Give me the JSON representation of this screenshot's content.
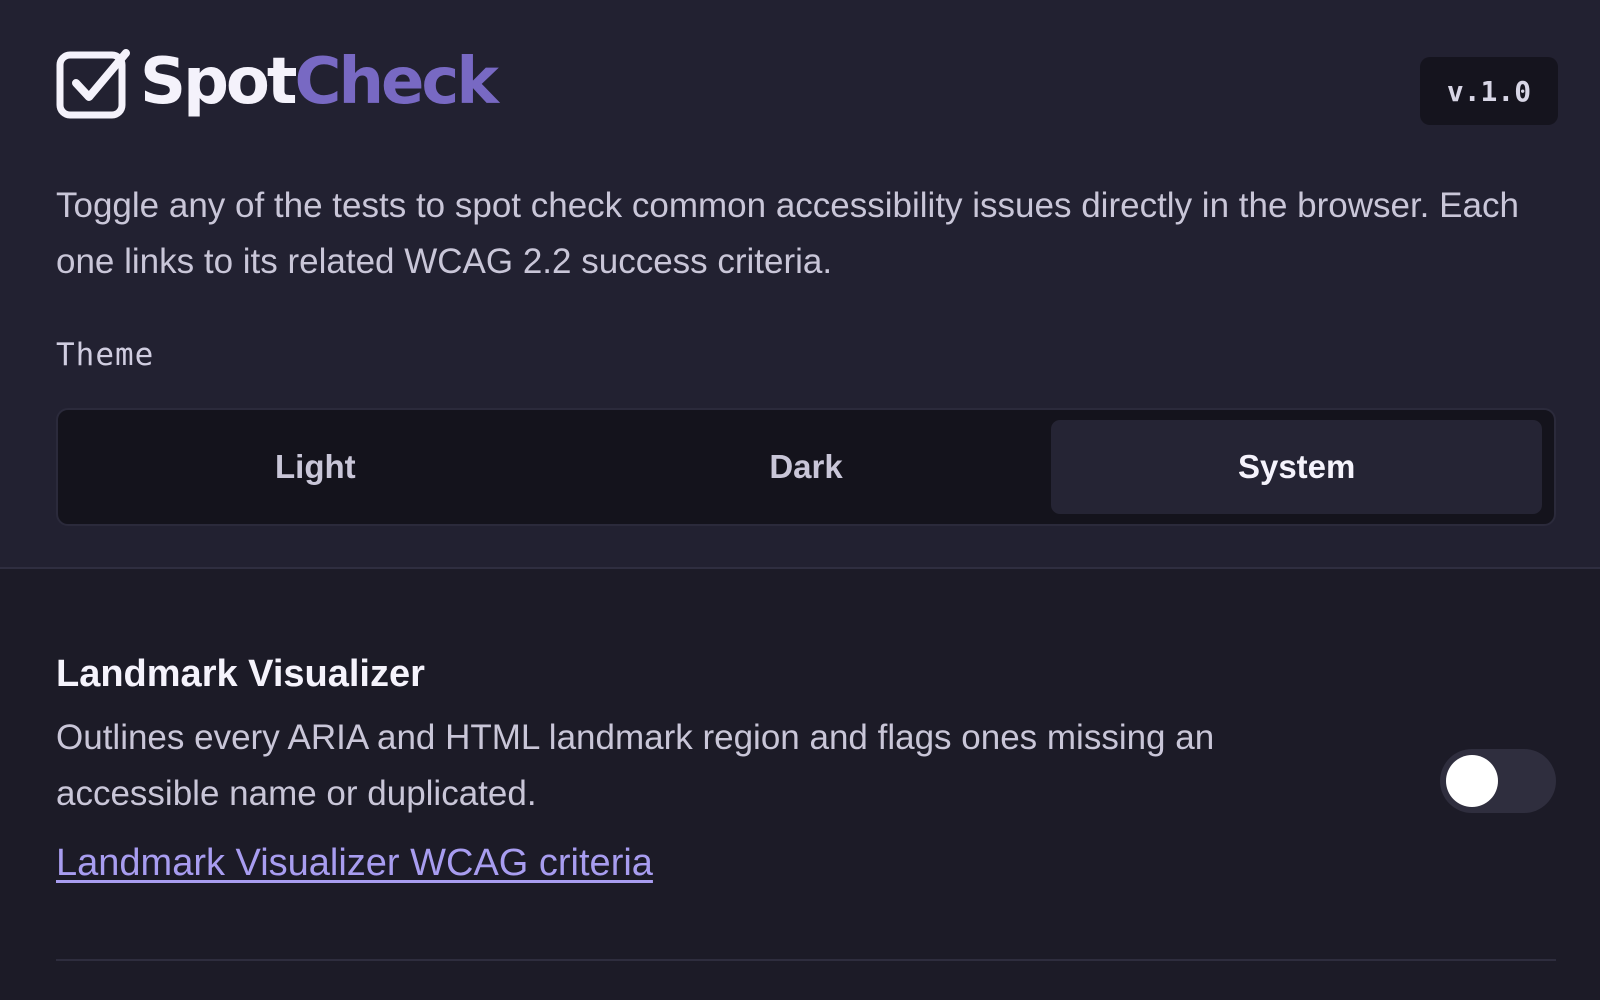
{
  "brand": {
    "name_part1": "Spot",
    "name_part2": "Check",
    "logo_icon": "checkbox-check-icon",
    "accent_color": "#7869c3"
  },
  "version": "v.1.0",
  "intro": "Toggle any of the tests to spot check common accessibility issues directly in the browser. Each one links to its related WCAG 2.2 success criteria.",
  "theme": {
    "label": "Theme",
    "options": [
      "Light",
      "Dark",
      "System"
    ],
    "selected": "System"
  },
  "tests": [
    {
      "title": "Landmark Visualizer",
      "description": "Outlines every ARIA and HTML landmark region and flags ones missing an accessible name or duplicated.",
      "link_text": "Landmark Visualizer WCAG criteria",
      "enabled": false
    }
  ],
  "colors": {
    "background": "#1c1b27",
    "panel": "#222131",
    "link": "#a89df0"
  }
}
